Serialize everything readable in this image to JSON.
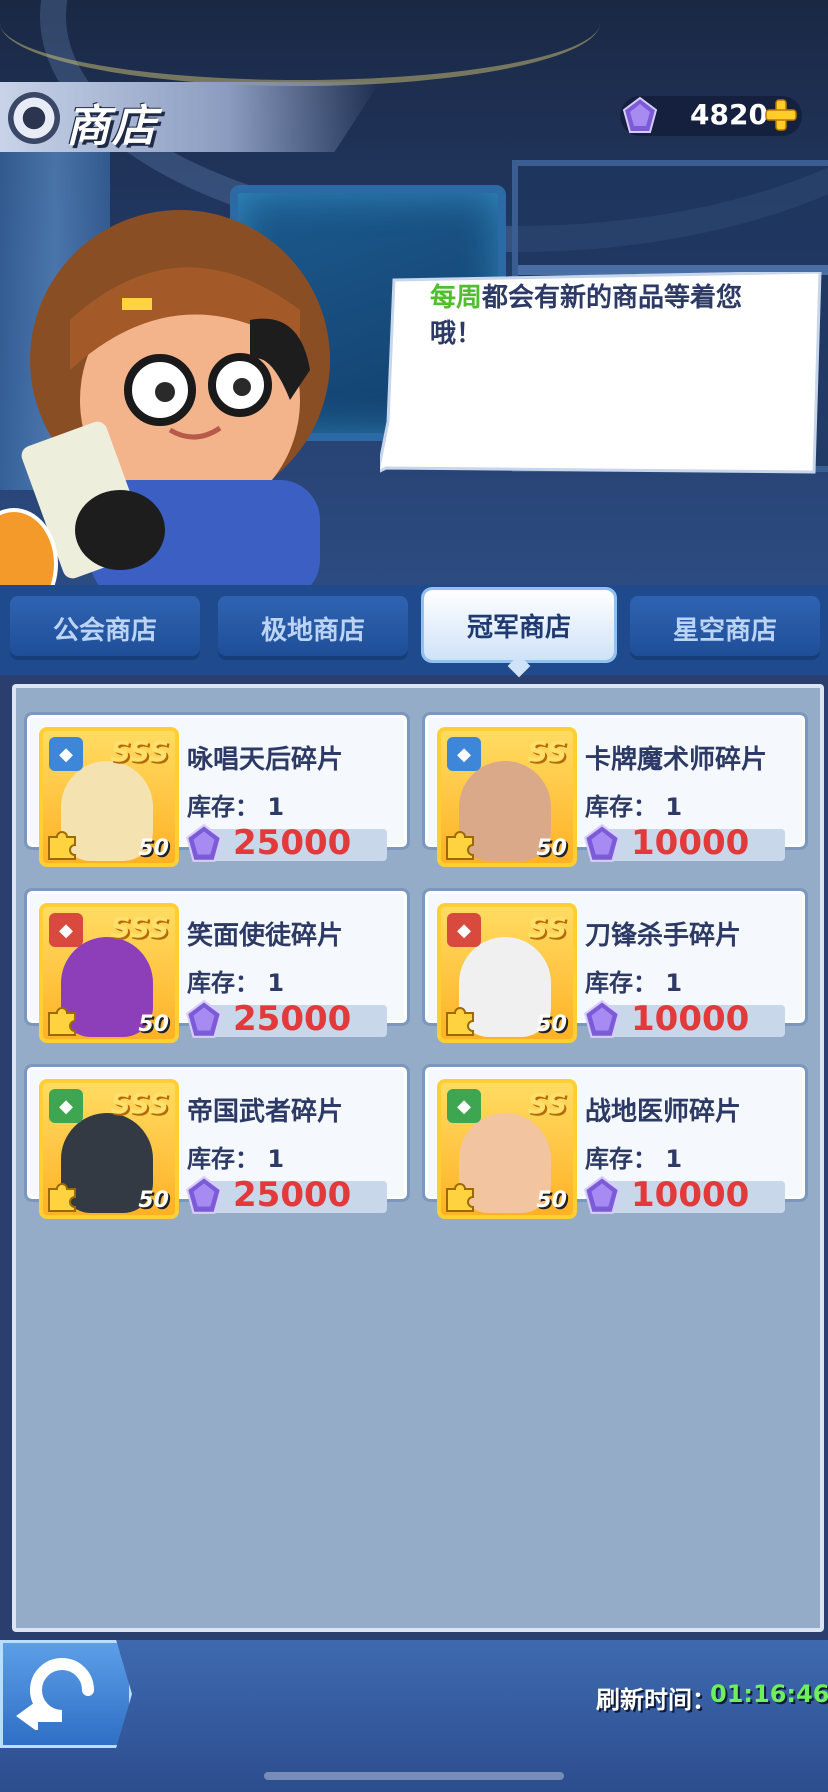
{
  "header": {
    "title": "商店",
    "currency_value": "4820",
    "currency_icon": "purple-gem-icon",
    "add_icon": "plus-icon"
  },
  "dialog": {
    "highlight": "每周",
    "text": "都会有新的商品等着您哦！"
  },
  "tabs": [
    {
      "label": "公会商店",
      "active": false
    },
    {
      "label": "极地商店",
      "active": false
    },
    {
      "label": "冠军商店",
      "active": true
    },
    {
      "label": "星空商店",
      "active": false
    }
  ],
  "items": [
    {
      "name": "咏唱天后碎片",
      "stock_label": "库存：",
      "stock": "1",
      "price": "25000",
      "rank": "SSS",
      "level": "50",
      "faction": "blue"
    },
    {
      "name": "卡牌魔术师碎片",
      "stock_label": "库存：",
      "stock": "1",
      "price": "10000",
      "rank": "SS",
      "level": "50",
      "faction": "blue"
    },
    {
      "name": "笑面使徒碎片",
      "stock_label": "库存：",
      "stock": "1",
      "price": "25000",
      "rank": "SSS",
      "level": "50",
      "faction": "red"
    },
    {
      "name": "刀锋杀手碎片",
      "stock_label": "库存：",
      "stock": "1",
      "price": "10000",
      "rank": "SS",
      "level": "50",
      "faction": "red"
    },
    {
      "name": "帝国武者碎片",
      "stock_label": "库存：",
      "stock": "1",
      "price": "25000",
      "rank": "SSS",
      "level": "50",
      "faction": "green"
    },
    {
      "name": "战地医师碎片",
      "stock_label": "库存：",
      "stock": "1",
      "price": "10000",
      "rank": "SS",
      "level": "50",
      "faction": "green"
    }
  ],
  "footer": {
    "refresh_label": "刷新时间：",
    "refresh_time": "01:16:46"
  },
  "colors": {
    "price": "#e2393b",
    "highlight": "#4fbf2e",
    "timer": "#6df05a",
    "text_primary": "#2d3a66"
  }
}
